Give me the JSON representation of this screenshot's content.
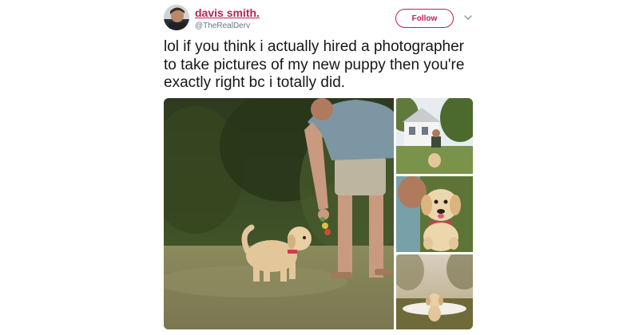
{
  "user": {
    "display_name": "davis smith.",
    "handle": "@TheRealDerv"
  },
  "actions": {
    "follow_label": "Follow",
    "more_icon": "chevron-down-icon"
  },
  "tweet": {
    "text": "lol if you think i actually hired a photographer\nto take pictures of my new puppy then you're\nexactly right bc i totally did."
  },
  "colors": {
    "accent": "#c21e56",
    "text": "#14171a",
    "muted": "#657786"
  }
}
